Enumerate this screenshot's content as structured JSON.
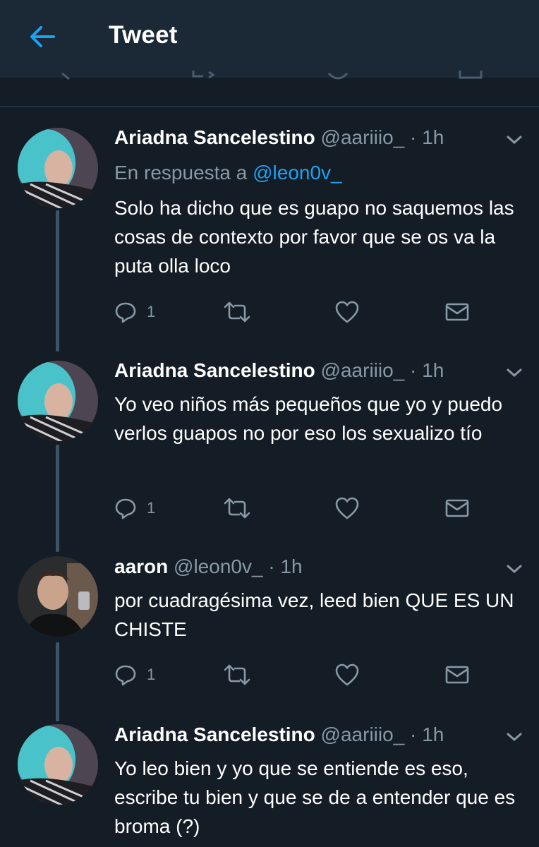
{
  "header": {
    "title": "Tweet"
  },
  "colors": {
    "background": "#141d26",
    "header_bg": "#1b2836",
    "accent": "#1da1f2",
    "muted": "#8899a6",
    "thread_line": "#3d5466"
  },
  "icons": {
    "back": "arrow-left-icon",
    "reply": "reply-icon",
    "retweet": "retweet-icon",
    "like": "heart-icon",
    "dm": "envelope-icon",
    "menu": "chevron-down-icon"
  },
  "tweets": [
    {
      "name": "Ariadna Sancelestino",
      "handle": "@aariiio_",
      "dot": "·",
      "time": "1h",
      "reply_prefix": "En respuesta a",
      "reply_to": "@leon0v_",
      "text": "Solo ha dicho que es guapo no saquemos las cosas de contexto por favor que se os va la puta olla loco",
      "reply_count": "1"
    },
    {
      "name": "Ariadna Sancelestino",
      "handle": "@aariiio_",
      "dot": "·",
      "time": "1h",
      "text": "Yo veo niños más pequeños que yo y puedo verlos guapos no por eso los sexualizo tío",
      "reply_count": "1"
    },
    {
      "name": "aaron",
      "handle": "@leon0v_",
      "dot": "·",
      "time": "1h",
      "text": "por cuadragésima vez, leed bien QUE ES UN CHISTE",
      "reply_count": "1"
    },
    {
      "name": "Ariadna Sancelestino",
      "handle": "@aariiio_",
      "dot": "·",
      "time": "1h",
      "text": "Yo leo bien y yo que se entiende es eso, escribe tu bien y que se de a entender que es broma (?)"
    }
  ]
}
